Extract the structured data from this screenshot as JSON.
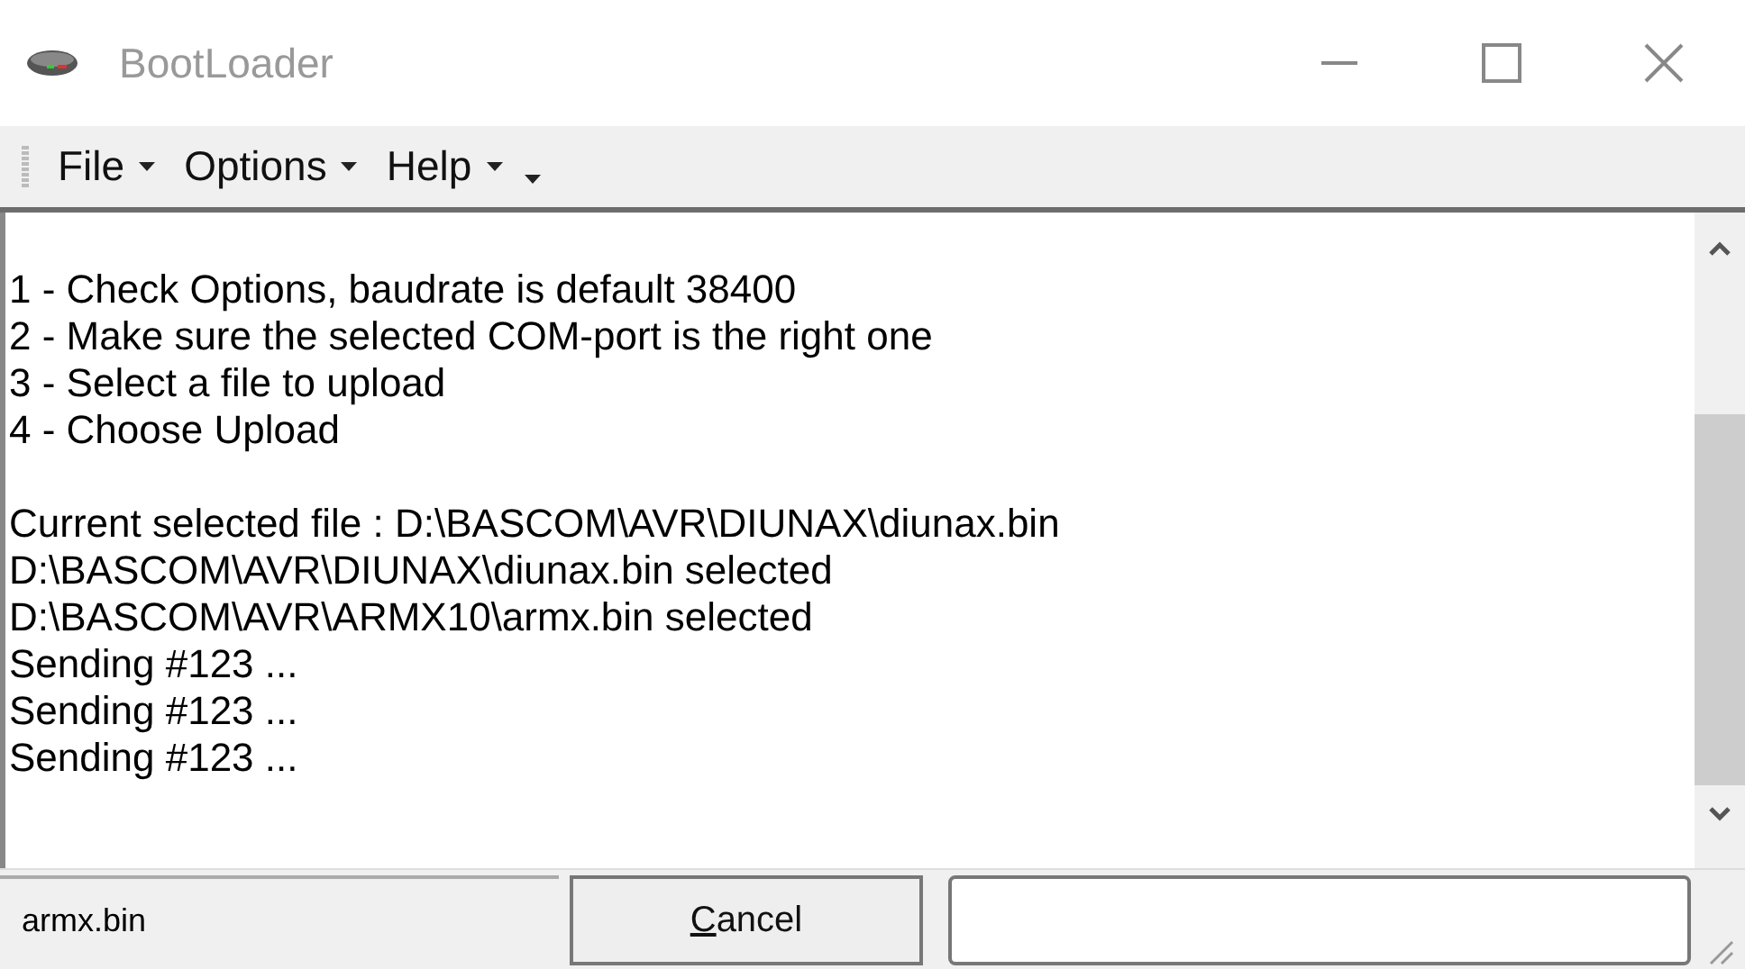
{
  "window": {
    "title": "BootLoader"
  },
  "menu": [
    {
      "label": "File",
      "has_dropdown": true
    },
    {
      "label": "Options",
      "has_dropdown": true
    },
    {
      "label": "Help",
      "has_dropdown": true
    }
  ],
  "log": [
    {
      "lines": [
        "1 - Check Options, baudrate is default 38400",
        "2 - Make sure the selected COM-port is the right one",
        "3 - Select a file to upload",
        "4 - Choose Upload"
      ]
    },
    {
      "lines": [
        "Current selected file : D:\\BASCOM\\AVR\\DIUNAX\\diunax.bin",
        "D:\\BASCOM\\AVR\\DIUNAX\\diunax.bin selected",
        "D:\\BASCOM\\AVR\\ARMX10\\armx.bin selected",
        "Sending #123 ...",
        "Sending #123 ...",
        "Sending #123 ..."
      ]
    }
  ],
  "status_bar": {
    "file": "armx.bin",
    "button": {
      "label": "Cancel",
      "mnemonic_underlined": true
    }
  }
}
